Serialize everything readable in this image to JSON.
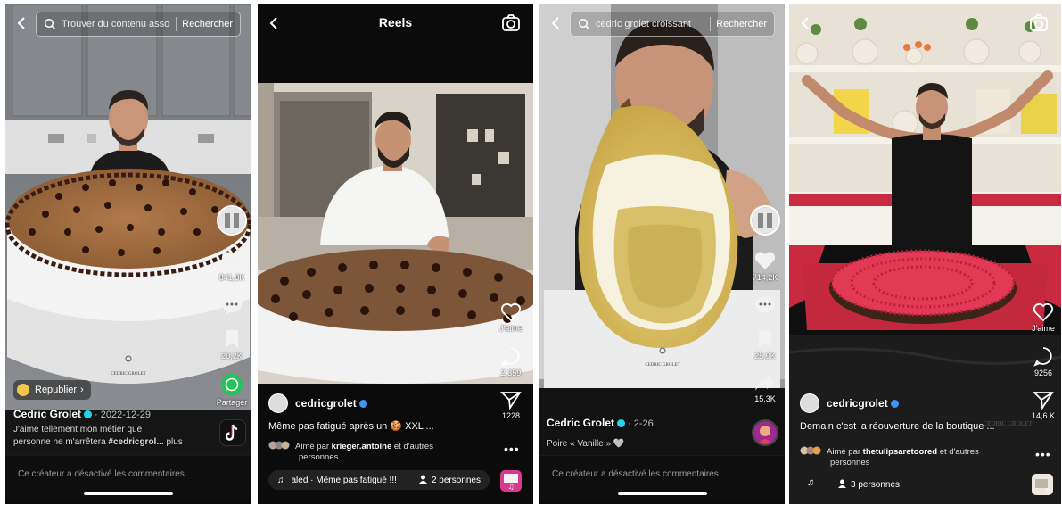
{
  "panels": {
    "p1": {
      "search": {
        "query": "Trouver du contenu asso...",
        "button": "Rechercher"
      },
      "rail": {
        "likes": "841,8K",
        "saves": "20,2K",
        "share": "Partager"
      },
      "repost": "Republier",
      "caption": {
        "user": "Cedric Grolet",
        "date": "· 2022-12-29",
        "text_line1": "J'aime tellement mon métier que",
        "text_line2": "personne ne m'arrêtera",
        "hashtag": "#cedricgrol...",
        "more": "plus"
      },
      "watermark": "CEDRIC GROLET",
      "comments_off": "Ce créateur a désactivé les commentaires"
    },
    "p2": {
      "title": "Reels",
      "rail": {
        "like_label": "J'aime",
        "comments": "2 359",
        "shares": "1228"
      },
      "caption": {
        "user": "cedricgrolet",
        "text": "Même pas fatigué après un 🍪 XXL ..."
      },
      "liked_by": {
        "prefix": "Aimé par",
        "user": "krieger.antoine",
        "suffix": "et d'autres",
        "line2": "personnes"
      },
      "music": "aled · Même pas fatigué !!!",
      "people": "2 personnes"
    },
    "p3": {
      "search": {
        "query": "cedric grolet croissant",
        "button": "Rechercher"
      },
      "rail": {
        "likes": "714,2K",
        "saves": "25,9K",
        "shares": "15,3K"
      },
      "caption": {
        "user": "Cedric Grolet",
        "date": "· 2-26",
        "text": "Poire « Vanille » 🤍"
      },
      "watermark": "CEDRIC GROLET",
      "comments_off": "Ce créateur a désactivé les commentaires"
    },
    "p4": {
      "rail": {
        "like_label": "J'aime",
        "comments": "9256",
        "shares": "14,6 K"
      },
      "caption": {
        "user": "cedricgrolet",
        "text": "Demain c'est la réouverture de la boutique ..."
      },
      "liked_by": {
        "prefix": "Aimé par",
        "user": "thetulipsaretoored",
        "suffix": "et d'autres",
        "line2": "personnes"
      },
      "watermark": "CEDRIC GROLET",
      "people": "3 personnes"
    }
  },
  "colors": {
    "verified": "#20d5ec",
    "share_green": "#25c15a",
    "repost_coin": "#f2c94c"
  }
}
